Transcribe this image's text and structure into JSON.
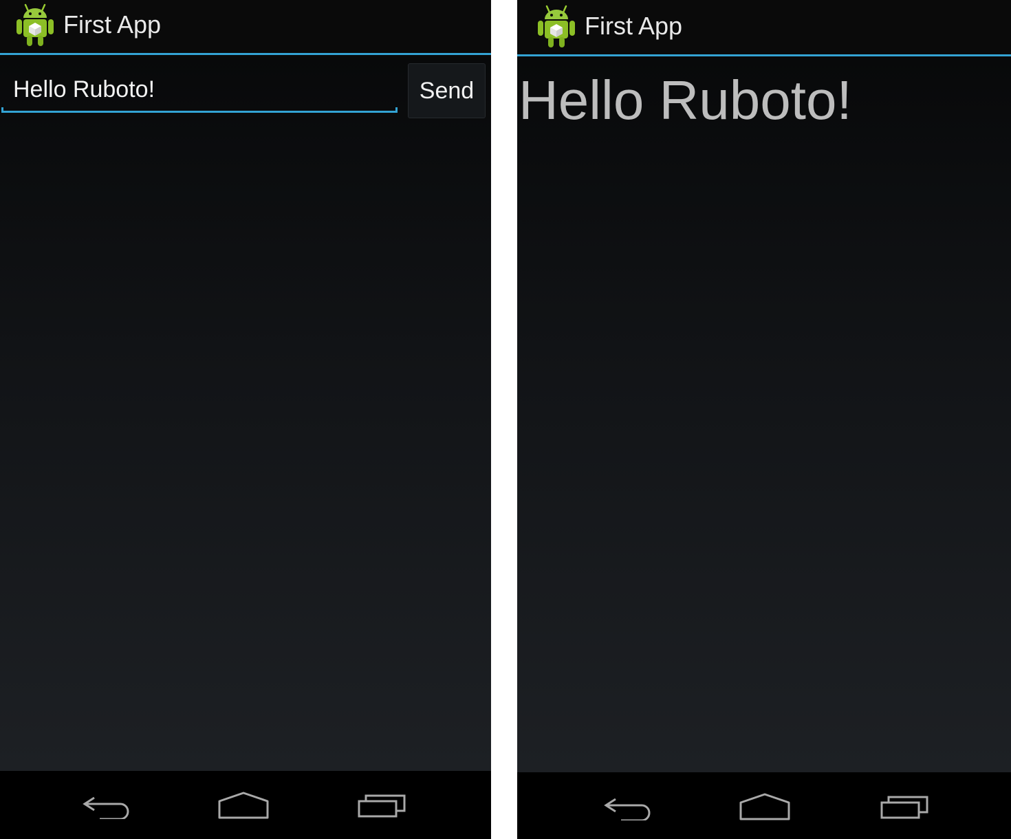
{
  "left_screen": {
    "app_title": "First App",
    "message_input": {
      "value": "Hello Ruboto!",
      "placeholder": ""
    },
    "send_button_label": "Send",
    "nav": [
      "back-icon",
      "home-icon",
      "recent-apps-icon"
    ]
  },
  "right_screen": {
    "app_title": "First App",
    "message_display": "Hello Ruboto!",
    "nav": [
      "back-icon",
      "home-icon",
      "recent-apps-icon"
    ]
  },
  "colors": {
    "accent": "#33a3d4",
    "android_green": "#8cbf26",
    "title_text": "#e9e9e9",
    "display_text": "#bdbdbd"
  }
}
